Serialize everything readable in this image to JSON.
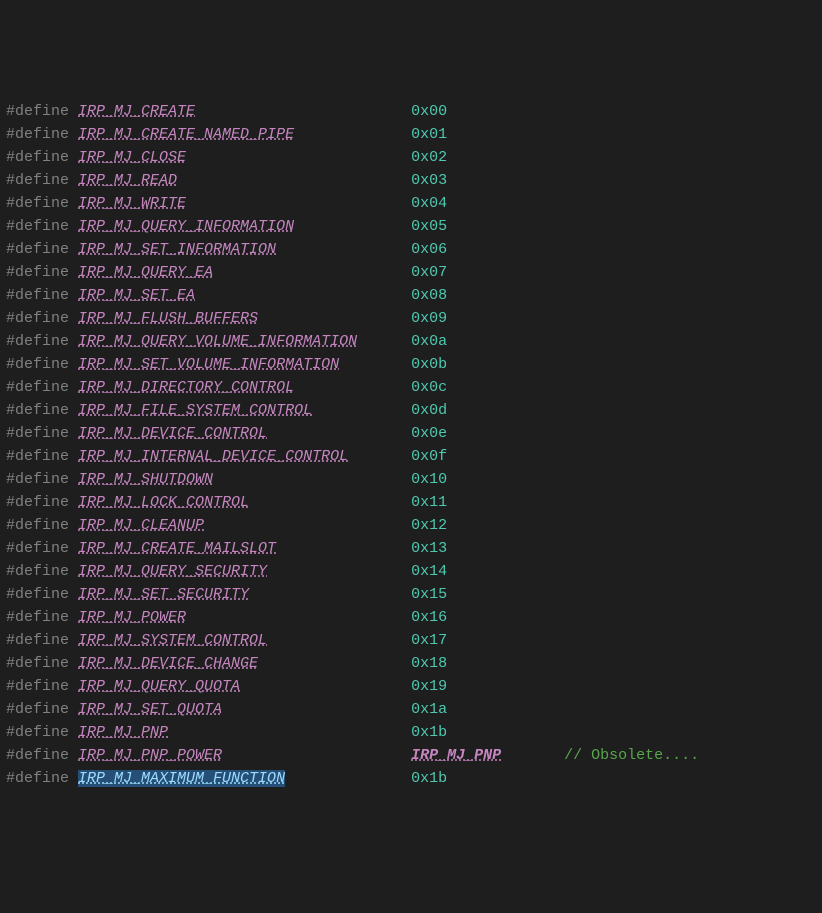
{
  "lines": [
    {
      "directive": "#define",
      "macro": "IRP_MJ_CREATE",
      "value": "0x00",
      "pad": 24
    },
    {
      "directive": "#define",
      "macro": "IRP_MJ_CREATE_NAMED_PIPE",
      "value": "0x01",
      "pad": 13
    },
    {
      "directive": "#define",
      "macro": "IRP_MJ_CLOSE",
      "value": "0x02",
      "pad": 25
    },
    {
      "directive": "#define",
      "macro": "IRP_MJ_READ",
      "value": "0x03",
      "pad": 26
    },
    {
      "directive": "#define",
      "macro": "IRP_MJ_WRITE",
      "value": "0x04",
      "pad": 25
    },
    {
      "directive": "#define",
      "macro": "IRP_MJ_QUERY_INFORMATION",
      "value": "0x05",
      "pad": 13
    },
    {
      "directive": "#define",
      "macro": "IRP_MJ_SET_INFORMATION",
      "value": "0x06",
      "pad": 15
    },
    {
      "directive": "#define",
      "macro": "IRP_MJ_QUERY_EA",
      "value": "0x07",
      "pad": 22
    },
    {
      "directive": "#define",
      "macro": "IRP_MJ_SET_EA",
      "value": "0x08",
      "pad": 24
    },
    {
      "directive": "#define",
      "macro": "IRP_MJ_FLUSH_BUFFERS",
      "value": "0x09",
      "pad": 17
    },
    {
      "directive": "#define",
      "macro": "IRP_MJ_QUERY_VOLUME_INFORMATION",
      "value": "0x0a",
      "pad": 6
    },
    {
      "directive": "#define",
      "macro": "IRP_MJ_SET_VOLUME_INFORMATION",
      "value": "0x0b",
      "pad": 8
    },
    {
      "directive": "#define",
      "macro": "IRP_MJ_DIRECTORY_CONTROL",
      "value": "0x0c",
      "pad": 13
    },
    {
      "directive": "#define",
      "macro": "IRP_MJ_FILE_SYSTEM_CONTROL",
      "value": "0x0d",
      "pad": 11
    },
    {
      "directive": "#define",
      "macro": "IRP_MJ_DEVICE_CONTROL",
      "value": "0x0e",
      "pad": 16
    },
    {
      "directive": "#define",
      "macro": "IRP_MJ_INTERNAL_DEVICE_CONTROL",
      "value": "0x0f",
      "pad": 7
    },
    {
      "directive": "#define",
      "macro": "IRP_MJ_SHUTDOWN",
      "value": "0x10",
      "pad": 22
    },
    {
      "directive": "#define",
      "macro": "IRP_MJ_LOCK_CONTROL",
      "value": "0x11",
      "pad": 18
    },
    {
      "directive": "#define",
      "macro": "IRP_MJ_CLEANUP",
      "value": "0x12",
      "pad": 23
    },
    {
      "directive": "#define",
      "macro": "IRP_MJ_CREATE_MAILSLOT",
      "value": "0x13",
      "pad": 15
    },
    {
      "directive": "#define",
      "macro": "IRP_MJ_QUERY_SECURITY",
      "value": "0x14",
      "pad": 16
    },
    {
      "directive": "#define",
      "macro": "IRP_MJ_SET_SECURITY",
      "value": "0x15",
      "pad": 18
    },
    {
      "directive": "#define",
      "macro": "IRP_MJ_POWER",
      "value": "0x16",
      "pad": 25
    },
    {
      "directive": "#define",
      "macro": "IRP_MJ_SYSTEM_CONTROL",
      "value": "0x17",
      "pad": 16
    },
    {
      "directive": "#define",
      "macro": "IRP_MJ_DEVICE_CHANGE",
      "value": "0x18",
      "pad": 17
    },
    {
      "directive": "#define",
      "macro": "IRP_MJ_QUERY_QUOTA",
      "value": "0x19",
      "pad": 19
    },
    {
      "directive": "#define",
      "macro": "IRP_MJ_SET_QUOTA",
      "value": "0x1a",
      "pad": 21
    },
    {
      "directive": "#define",
      "macro": "IRP_MJ_PNP",
      "value": "0x1b",
      "pad": 27
    },
    {
      "directive": "#define",
      "macro": "IRP_MJ_PNP_POWER",
      "ref": "IRP_MJ_PNP",
      "comment": "// Obsolete....",
      "pad": 21,
      "refpad": 7
    },
    {
      "directive": "#define",
      "macro": "IRP_MJ_MAXIMUM_FUNCTION",
      "value": "0x1b",
      "pad": 14,
      "selected": true
    }
  ]
}
